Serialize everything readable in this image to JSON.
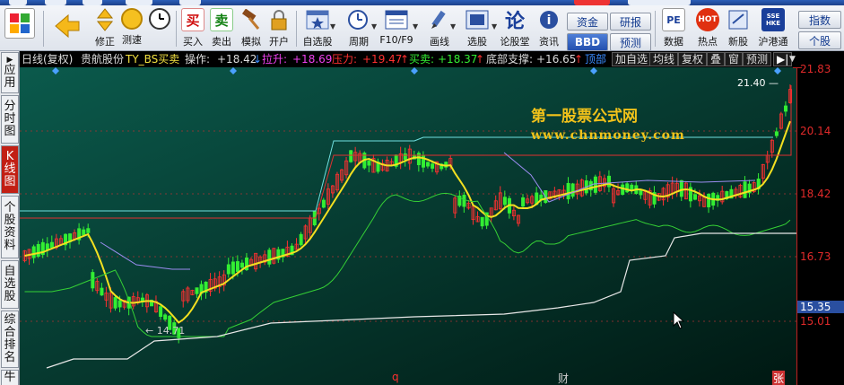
{
  "toolbar": {
    "buttons": [
      {
        "label": "",
        "icon": "grid-icon"
      },
      {
        "label": "",
        "icon": "back-arrow-icon"
      },
      {
        "label": "修正",
        "icon": "updown-icon"
      },
      {
        "label": "测速",
        "icon": "clock-icon"
      },
      {
        "label": "买入",
        "icon_text": "买"
      },
      {
        "label": "卖出",
        "icon_text": "卖"
      },
      {
        "label": "模拟",
        "icon": "hammer-icon"
      },
      {
        "label": "开户",
        "icon": "lock-icon"
      },
      {
        "label": "自选股",
        "icon": "star-window-icon"
      },
      {
        "label": "周期",
        "icon": "period-icon"
      },
      {
        "label": "F10/F9",
        "icon": "f10-icon"
      },
      {
        "label": "画线",
        "icon": "pencil-icon"
      },
      {
        "label": "选股",
        "icon": "select-stock-icon"
      },
      {
        "label": "论股堂",
        "icon_text": "论"
      },
      {
        "label": "资讯",
        "icon": "info-icon"
      },
      {
        "label": "数据",
        "icon_text": "PE"
      },
      {
        "label": "热点",
        "icon_text": "HOT"
      },
      {
        "label": "新股",
        "icon": "new-stock-icon"
      },
      {
        "label": "沪港通",
        "icon_text": "SSE HKE"
      }
    ],
    "small_buttons": {
      "zijin": "资金",
      "bbd": "BBD",
      "yanbao": "研报",
      "yuce": "预测",
      "zhishu": "指数",
      "gegu": "个股"
    }
  },
  "sidebar": {
    "tabs": [
      "应用",
      "分时图",
      "K线图",
      "个股资料",
      "自选股",
      "综合排名",
      "牛"
    ]
  },
  "infobar": {
    "period": "日线(复权)",
    "stock": "贵航股份",
    "indicator": "TY_BS买卖",
    "operate_label": "操作:",
    "operate_value": "+18.42",
    "lasheng_label": "拉升:",
    "lasheng_value": "+18.69",
    "yali_label": "压力:",
    "yali_value": "+19.47",
    "maimai_label": "买卖:",
    "maimai_value": "+18.37",
    "zhicheng_label": "底部支撑:",
    "zhicheng_value": "+16.65",
    "dingbu_label": "顶部",
    "buttons": [
      "加自选",
      "均线",
      "复权",
      "叠",
      "窗",
      "预测"
    ]
  },
  "chart": {
    "watermark_title": "第一股票公式网",
    "watermark_url": "www.chnmoney.com",
    "high_label": "21.40",
    "low_label": "14.71",
    "bottom_marks": {
      "q": "q",
      "cai": "财",
      "zhang": "张"
    },
    "colors": {
      "up": "#ff3030",
      "down": "#33ee33",
      "bg_top": "#0b5a4c",
      "bg_bottom": "#001a14"
    }
  },
  "yaxis": {
    "labels": [
      "21.83",
      "20.14",
      "18.42",
      "16.73",
      "15.35",
      "15.01"
    ]
  }
}
